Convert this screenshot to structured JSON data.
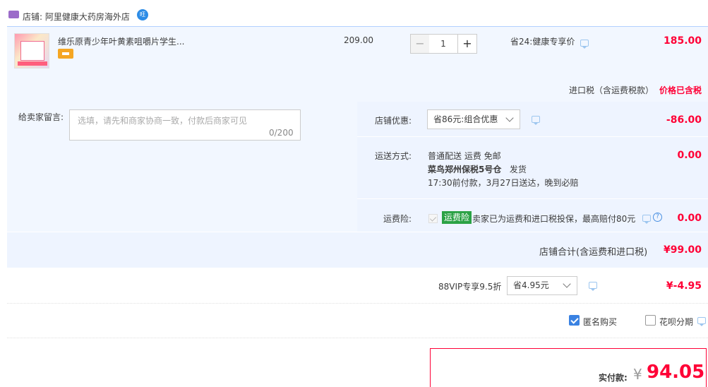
{
  "shop": {
    "label": "店铺: 阿里健康大药房海外店",
    "badge_text": "旺"
  },
  "item": {
    "title": "维乐原青少年叶黄素咀嚼片学生...",
    "unit_price": "209.00",
    "quantity": "1",
    "qty_minus": "−",
    "qty_plus": "+",
    "promo": "省24:健康专享价",
    "line_price": "185.00",
    "tax_label": "进口税（含运费税款）",
    "tax_value": "价格已含税"
  },
  "message": {
    "label": "给卖家留言:",
    "placeholder": "选填，请先和商家协商一致，付款后商家可见",
    "count": "0/200"
  },
  "shop_discount": {
    "label": "店铺优惠:",
    "selected": "省86元:组合优惠",
    "value": "-86.00"
  },
  "shipping": {
    "label": "运送方式:",
    "line1": "普通配送 运费 免邮",
    "warehouse": "菜鸟郑州保税5号仓",
    "ship_action": "发货",
    "line3": "17:30前付款，3月27日送达，晚到必赔",
    "value": "0.00"
  },
  "insurance": {
    "label": "运费险:",
    "badge": "运费险",
    "text": "卖家已为运费和进口税投保，最高赔付80元",
    "help": "?",
    "value": "0.00"
  },
  "total": {
    "label": "店铺合计(含运费和进口税)",
    "value": "¥99.00"
  },
  "vip": {
    "label": "88VIP专享9.5折",
    "selected": "省4.95元",
    "value": "¥-4.95"
  },
  "options": {
    "anonymous_label": "匿名购买",
    "huabei_label": "花呗分期"
  },
  "payment": {
    "label": "实付款:",
    "currency": "¥",
    "value": "94.05"
  },
  "colors": {
    "accent_red": "#ff0036",
    "panel_blue": "#f2f7ff",
    "border_blue": "#b2d1ff",
    "check_blue": "#3a82e2",
    "insurance_green": "#2ba245"
  }
}
